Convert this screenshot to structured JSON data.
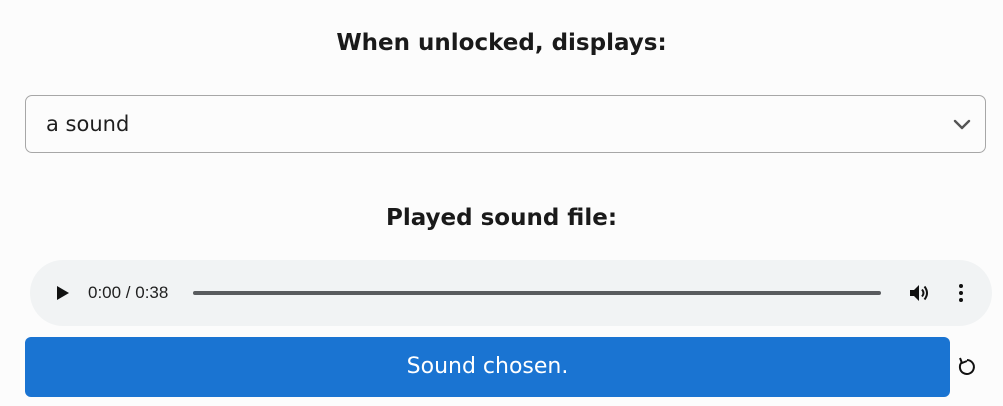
{
  "unlock_section": {
    "heading": "When unlocked, displays:",
    "select": {
      "selected_value": "a sound",
      "icon": "chevron-down-icon"
    }
  },
  "sound_section": {
    "heading": "Played sound file:",
    "player": {
      "time": "0:00 / 0:38",
      "progress": 0,
      "icons": [
        "play-icon",
        "volume-icon",
        "more-options-icon"
      ]
    }
  },
  "actions": {
    "chosen_label": "Sound chosen.",
    "reset_icon": "reset-icon",
    "accent": "#1a74d2"
  }
}
